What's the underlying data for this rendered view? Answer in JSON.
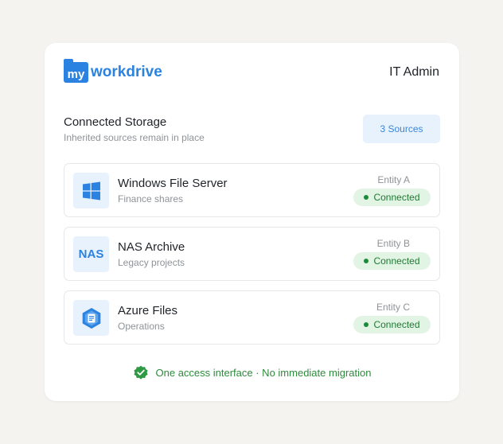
{
  "header": {
    "logo_prefix": "my",
    "logo_name": "workdrive",
    "user": "IT Admin"
  },
  "section": {
    "title": "Connected Storage",
    "subtitle": "Inherited sources remain in place",
    "badge": "3 Sources"
  },
  "sources": [
    {
      "icon": "windows-icon",
      "name": "Windows File Server",
      "desc": "Finance shares",
      "entity": "Entity A",
      "status": "Connected"
    },
    {
      "icon": "nas-icon",
      "icon_text": "NAS",
      "name": "NAS Archive",
      "desc": "Legacy projects",
      "entity": "Entity B",
      "status": "Connected"
    },
    {
      "icon": "azure-files-icon",
      "name": "Azure Files",
      "desc": "Operations",
      "entity": "Entity C",
      "status": "Connected"
    }
  ],
  "footer": {
    "text": "One access interface · No immediate migration"
  },
  "colors": {
    "brand": "#2b82e0",
    "success": "#1f8a36",
    "background": "#f4f3ef"
  }
}
